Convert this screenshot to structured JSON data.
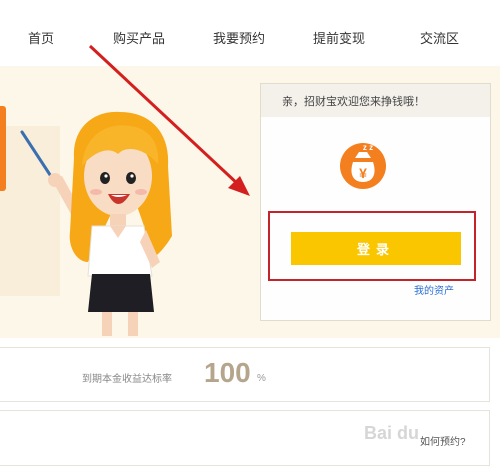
{
  "nav": {
    "items": [
      {
        "label": "首页"
      },
      {
        "label": "购买产品"
      },
      {
        "label": "我要预约"
      },
      {
        "label": "提前变现"
      },
      {
        "label": "交流区"
      }
    ]
  },
  "card": {
    "greeting": "亲，招财宝欢迎您来挣钱哦！",
    "login_label": "登录",
    "assets_link": "我的资产",
    "icon_glyph": "¥",
    "icon_zz": "z z"
  },
  "stats": {
    "label": "到期本金收益达标率",
    "value": "100",
    "unit": "%"
  },
  "footer": {
    "how_link": "如何预约?"
  },
  "watermark": {
    "text": "Bai du"
  },
  "colors": {
    "accent_orange": "#f37f1f",
    "login_yellow": "#f9c600",
    "highlight_red": "#c3242a",
    "link_blue": "#2d6fd1"
  }
}
